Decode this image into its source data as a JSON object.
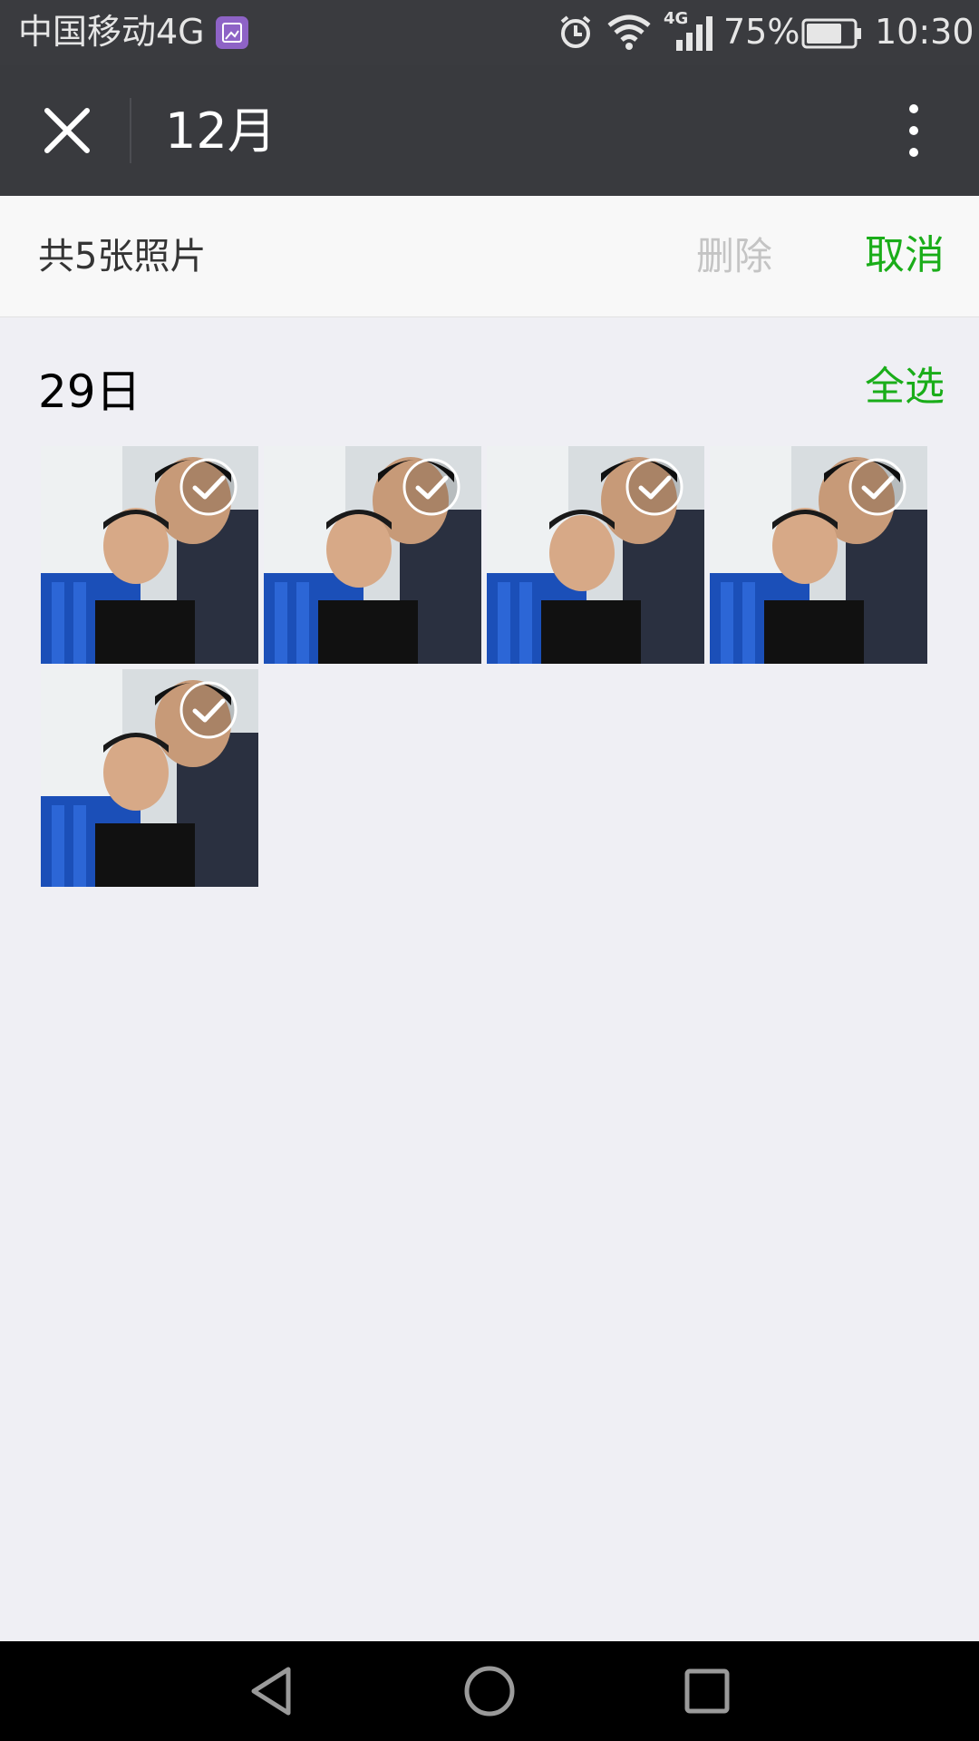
{
  "status_bar": {
    "carrier": "中国移动4G",
    "network_type": "4G",
    "battery_percent": "75%",
    "battery_level": 0.75,
    "time": "10:30"
  },
  "title_bar": {
    "title": "12月"
  },
  "action_bar": {
    "count_text": "共5张照片",
    "delete_label": "删除",
    "cancel_label": "取消"
  },
  "section": {
    "date": "29日",
    "select_all_label": "全选",
    "photo_count": 5
  },
  "colors": {
    "accent_green": "#1aad19",
    "status_bar_bg": "#3a3b3f",
    "title_bar_bg": "#393a3e",
    "page_bg": "#efeff4",
    "disabled_text": "#c4c4c4"
  }
}
